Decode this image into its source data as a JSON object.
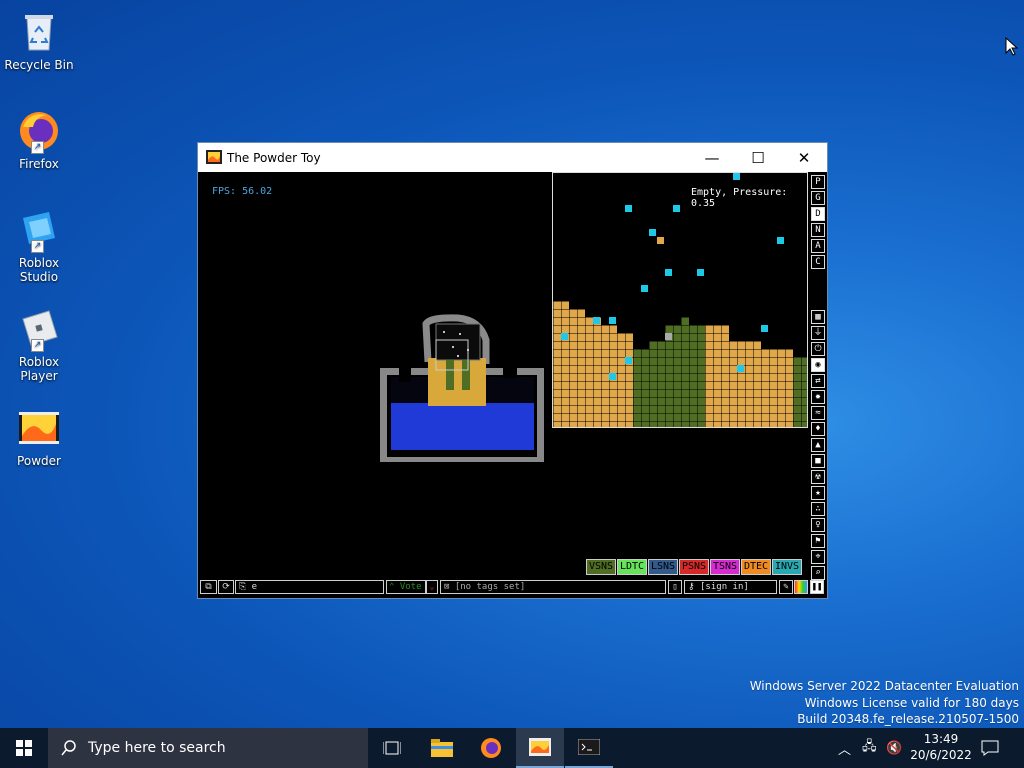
{
  "desktop": {
    "icons": [
      {
        "label": "Recycle Bin"
      },
      {
        "label": "Firefox"
      },
      {
        "label": "Roblox Studio"
      },
      {
        "label": "Roblox Player"
      },
      {
        "label": "Powder"
      }
    ]
  },
  "window": {
    "title": "The Powder Toy",
    "minimize_glyph": "—",
    "maximize_glyph": "☐",
    "close_glyph": "✕"
  },
  "sim": {
    "fps": "FPS: 56.02",
    "hud": "Empty, Pressure: 0.35"
  },
  "sidebar": {
    "menu_letters": [
      "P",
      "G",
      "D",
      "N",
      "A",
      "C"
    ],
    "category_icons": [
      "wall-icon",
      "electronics-icon",
      "power-icon",
      "sensor-icon",
      "force-icon",
      "explosive-icon",
      "gas-icon",
      "liquid-icon",
      "powder-icon",
      "solid-icon",
      "radioactive-icon",
      "special-icon",
      "particles-icon",
      "life-icon",
      "tools-icon",
      "favorites-icon",
      "search-icon"
    ]
  },
  "elements": [
    {
      "label": "VSNS",
      "color": "#4f6e23"
    },
    {
      "label": "LDTC",
      "color": "#66e35b"
    },
    {
      "label": "LSNS",
      "color": "#335a8a"
    },
    {
      "label": "PSNS",
      "color": "#d42a2a"
    },
    {
      "label": "TSNS",
      "color": "#d62bd0"
    },
    {
      "label": "DTEC",
      "color": "#f08a22"
    },
    {
      "label": "INVS",
      "color": "#29a8b2"
    }
  ],
  "bottombar": {
    "save_name": "e",
    "vote_label": "Vote",
    "tags_placeholder": "[no tags set]",
    "sign_in_label": "[sign in]"
  },
  "watermark": {
    "line1": "Windows Server 2022 Datacenter Evaluation",
    "line2": "Windows License valid for 180 days",
    "line3": "Build 20348.fe_release.210507-1500"
  },
  "taskbar": {
    "search_placeholder": "Type here to search",
    "time": "13:49",
    "date": "20/6/2022"
  }
}
